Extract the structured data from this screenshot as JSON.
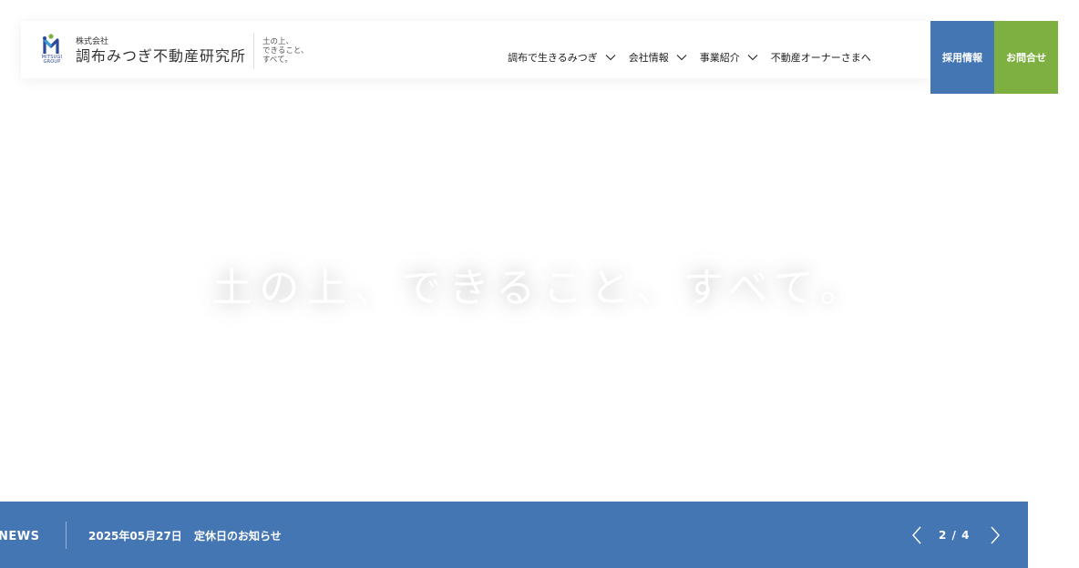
{
  "header": {
    "logo": {
      "group_text": "MITSUGI GROUP",
      "small": "株式会社",
      "main": "調布みつぎ不動産研究所",
      "tagline": [
        "土の上、",
        "できること、",
        "すべて。"
      ]
    },
    "nav": [
      {
        "label": "調布で生きるみつぎ",
        "icon": "chevron-down-icon"
      },
      {
        "label": "会社情報",
        "icon": "chevron-down-icon"
      },
      {
        "label": "事業紹介",
        "icon": "chevron-down-icon"
      },
      {
        "label": "不動産オーナーさまへ"
      }
    ],
    "buttons": {
      "recruit": "採用情報",
      "contact": "お問合せ"
    }
  },
  "hero": {
    "copy": "土の上、できること、すべて。"
  },
  "news": {
    "label": "NEWS",
    "date": "2025年05月27日",
    "title": "定休日のお知らせ",
    "page": "2 / 4",
    "prev_icon": "chevron-left-icon",
    "next_icon": "chevron-right-icon"
  },
  "colors": {
    "primary_blue": "#4576b4",
    "accent_green": "#7eb041"
  }
}
